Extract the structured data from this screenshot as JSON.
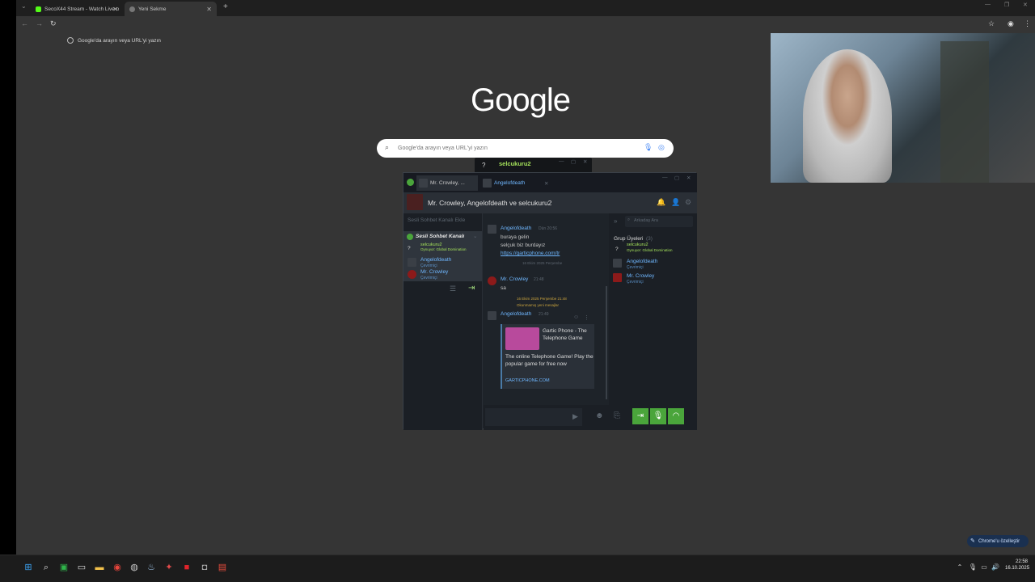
{
  "browser": {
    "tabs": [
      {
        "label": "SecoX44 Stream - Watch Live o",
        "active": false
      },
      {
        "label": "Yeni Sekme",
        "active": true
      }
    ],
    "omnibox_placeholder": "Google'da arayın veya URL'yi yazın",
    "logo_text": "Google",
    "search_placeholder": "Google'da arayın veya URL'yi yazın",
    "customize_label": "Chrome'u özelleştir"
  },
  "steam": {
    "floating_title": "selcukuru2",
    "tabs": [
      {
        "label": "Mr. Crowley, ..."
      },
      {
        "label": "Angelofdeath"
      }
    ],
    "header_title": "Mr. Crowley, Angelofdeath ve selcukuru2",
    "left": {
      "add_voice": "Sesli Sohbet Kanalı Ekle",
      "voice_channel": "Sesli Sohbet Kanalı",
      "members": [
        {
          "name": "selcukuru2",
          "status": "Oynuyor: Global Domination"
        },
        {
          "name": "Angelofdeath",
          "status": "Çevrimiçi"
        },
        {
          "name": "Mr. Crowley",
          "status": "Çevrimiçi"
        }
      ]
    },
    "messages": [
      {
        "author": "Angelofdeath",
        "time": "Dün 20:56",
        "lines": [
          "buraya gelin",
          "selçuk biz burdayız"
        ],
        "link": "https://garticphone.com/tr"
      },
      {
        "divider": "16 Ekim 2025 Perşembe"
      },
      {
        "author": "Mr. Crowley",
        "time": "21:48",
        "lines": [
          "sa"
        ]
      },
      {
        "divider": "16 Ekim 2025 Perşembe 21:48"
      },
      {
        "new_label": "Okunmamış yeni mesajlar"
      },
      {
        "author": "Angelofdeath",
        "time": "21:49"
      }
    ],
    "card": {
      "title": "Gartic Phone - The Telephone Game",
      "description": "The online Telephone Game! Play the popular game for free now",
      "domain": "GARTICPHONE.COM"
    },
    "right": {
      "search_placeholder": "Arkadaş Ara",
      "group_title": "Grup Üyeleri",
      "group_count": "(3)",
      "members": [
        {
          "name": "selcukuru2",
          "status": "Oynuyor: Global Domination"
        },
        {
          "name": "Angelofdeath",
          "status": "Çevrimiçi"
        },
        {
          "name": "Mr. Crowley",
          "status": "Çevrimiçi"
        }
      ]
    }
  },
  "taskbar": {
    "time": "22:58",
    "date": "16.10.2025"
  },
  "colors": {
    "chrome_bg": "#353535",
    "steam_bg": "#1e2329",
    "steam_green": "#4aa53b",
    "steam_blue": "#6fb7ff"
  }
}
